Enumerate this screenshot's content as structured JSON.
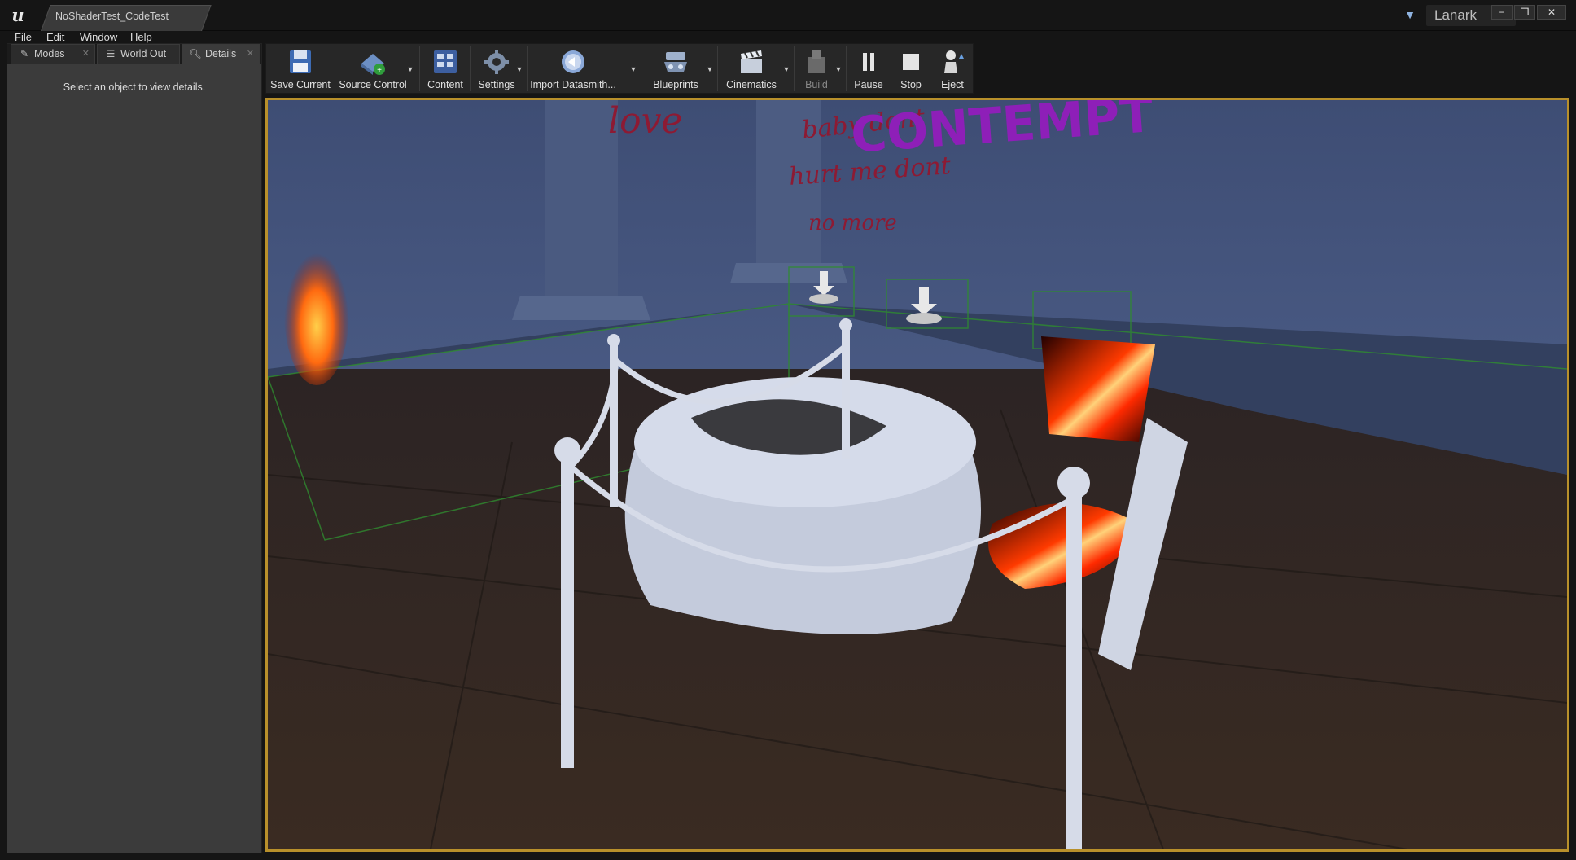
{
  "window": {
    "tab_title": "NoShaderTest_CodeTest",
    "project_name": "Lanark",
    "controls": [
      "−",
      "❐",
      "✕"
    ]
  },
  "menu": [
    "File",
    "Edit",
    "Window",
    "Help"
  ],
  "panel_tabs": [
    {
      "label": "Modes",
      "icon": "modes-icon"
    },
    {
      "label": "World Out",
      "icon": "world-outliner-icon"
    },
    {
      "label": "Details",
      "icon": "details-icon"
    }
  ],
  "details": {
    "hint": "Select an object to view details."
  },
  "toolbar": {
    "save_current": "Save Current",
    "source_control": "Source Control",
    "content": "Content",
    "settings": "Settings",
    "import_datasmith": "Import Datasmith...",
    "blueprints": "Blueprints",
    "cinematics": "Cinematics",
    "build": "Build",
    "pause": "Pause",
    "stop": "Stop",
    "eject": "Eject"
  },
  "scene": {
    "wall_texts": {
      "love": "love",
      "baby": "baby dont",
      "hurt": "hurt me dont",
      "nomore": "no more",
      "contempt": "CONTEMPT"
    }
  },
  "colors": {
    "viewport_border": "#b8902b",
    "panel_bg": "#3b3b3b",
    "toolbar_bg": "#272727",
    "accent_purple": "#8e1fb8",
    "graffiti_red": "#8d1a33"
  }
}
